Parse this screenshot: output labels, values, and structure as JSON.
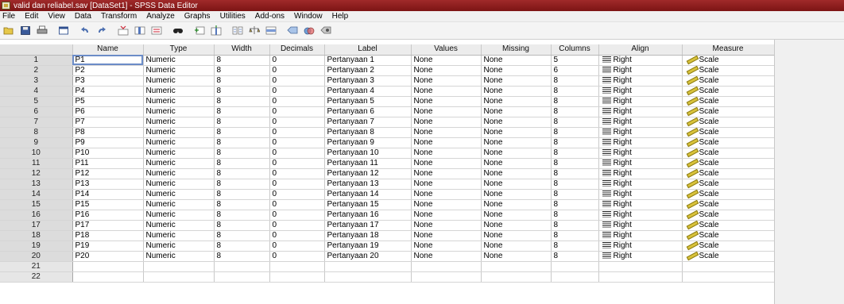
{
  "window": {
    "title": "valid dan reliabel.sav [DataSet1] - SPSS Data Editor"
  },
  "menu": {
    "items": [
      "File",
      "Edit",
      "View",
      "Data",
      "Transform",
      "Analyze",
      "Graphs",
      "Utilities",
      "Add-ons",
      "Window",
      "Help"
    ]
  },
  "toolbar": {
    "icons": [
      "open-icon",
      "save-icon",
      "print-icon",
      "dialog-recall-icon",
      "undo-icon",
      "redo-icon",
      "goto-case-icon",
      "goto-variable-icon",
      "variables-icon",
      "find-icon",
      "insert-cases-icon",
      "insert-variable-icon",
      "split-file-icon",
      "weight-cases-icon",
      "select-cases-icon",
      "value-labels-icon",
      "use-sets-icon",
      "show-all-variables-icon"
    ]
  },
  "grid": {
    "headers": [
      "Name",
      "Type",
      "Width",
      "Decimals",
      "Label",
      "Values",
      "Missing",
      "Columns",
      "Align",
      "Measure"
    ],
    "row_numbers": [
      "1",
      "2",
      "3",
      "4",
      "5",
      "6",
      "7",
      "8",
      "9",
      "10",
      "11",
      "12",
      "13",
      "14",
      "15",
      "16",
      "17",
      "18",
      "19",
      "20",
      "21",
      "22"
    ],
    "rows": [
      {
        "name": "P1",
        "type": "Numeric",
        "width": "8",
        "decimals": "0",
        "label": "Pertanyaan 1",
        "values": "None",
        "missing": "None",
        "columns": "5",
        "align": "Right",
        "measure": "Scale"
      },
      {
        "name": "P2",
        "type": "Numeric",
        "width": "8",
        "decimals": "0",
        "label": "Pertanyaan 2",
        "values": "None",
        "missing": "None",
        "columns": "6",
        "align": "Right",
        "measure": "Scale"
      },
      {
        "name": "P3",
        "type": "Numeric",
        "width": "8",
        "decimals": "0",
        "label": "Pertanyaan 3",
        "values": "None",
        "missing": "None",
        "columns": "8",
        "align": "Right",
        "measure": "Scale"
      },
      {
        "name": "P4",
        "type": "Numeric",
        "width": "8",
        "decimals": "0",
        "label": "Pertanyaan 4",
        "values": "None",
        "missing": "None",
        "columns": "8",
        "align": "Right",
        "measure": "Scale"
      },
      {
        "name": "P5",
        "type": "Numeric",
        "width": "8",
        "decimals": "0",
        "label": "Pertanyaan 5",
        "values": "None",
        "missing": "None",
        "columns": "8",
        "align": "Right",
        "measure": "Scale"
      },
      {
        "name": "P6",
        "type": "Numeric",
        "width": "8",
        "decimals": "0",
        "label": "Pertanyaan 6",
        "values": "None",
        "missing": "None",
        "columns": "8",
        "align": "Right",
        "measure": "Scale"
      },
      {
        "name": "P7",
        "type": "Numeric",
        "width": "8",
        "decimals": "0",
        "label": "Pertanyaan 7",
        "values": "None",
        "missing": "None",
        "columns": "8",
        "align": "Right",
        "measure": "Scale"
      },
      {
        "name": "P8",
        "type": "Numeric",
        "width": "8",
        "decimals": "0",
        "label": "Pertanyaan 8",
        "values": "None",
        "missing": "None",
        "columns": "8",
        "align": "Right",
        "measure": "Scale"
      },
      {
        "name": "P9",
        "type": "Numeric",
        "width": "8",
        "decimals": "0",
        "label": "Pertanyaan 9",
        "values": "None",
        "missing": "None",
        "columns": "8",
        "align": "Right",
        "measure": "Scale"
      },
      {
        "name": "P10",
        "type": "Numeric",
        "width": "8",
        "decimals": "0",
        "label": "Pertanyaan 10",
        "values": "None",
        "missing": "None",
        "columns": "8",
        "align": "Right",
        "measure": "Scale"
      },
      {
        "name": "P11",
        "type": "Numeric",
        "width": "8",
        "decimals": "0",
        "label": "Pertanyaan 11",
        "values": "None",
        "missing": "None",
        "columns": "8",
        "align": "Right",
        "measure": "Scale"
      },
      {
        "name": "P12",
        "type": "Numeric",
        "width": "8",
        "decimals": "0",
        "label": "Pertanyaan 12",
        "values": "None",
        "missing": "None",
        "columns": "8",
        "align": "Right",
        "measure": "Scale"
      },
      {
        "name": "P13",
        "type": "Numeric",
        "width": "8",
        "decimals": "0",
        "label": "Pertanyaan 13",
        "values": "None",
        "missing": "None",
        "columns": "8",
        "align": "Right",
        "measure": "Scale"
      },
      {
        "name": "P14",
        "type": "Numeric",
        "width": "8",
        "decimals": "0",
        "label": "Pertanyaan 14",
        "values": "None",
        "missing": "None",
        "columns": "8",
        "align": "Right",
        "measure": "Scale"
      },
      {
        "name": "P15",
        "type": "Numeric",
        "width": "8",
        "decimals": "0",
        "label": "Pertanyaan 15",
        "values": "None",
        "missing": "None",
        "columns": "8",
        "align": "Right",
        "measure": "Scale"
      },
      {
        "name": "P16",
        "type": "Numeric",
        "width": "8",
        "decimals": "0",
        "label": "Pertanyaan 16",
        "values": "None",
        "missing": "None",
        "columns": "8",
        "align": "Right",
        "measure": "Scale"
      },
      {
        "name": "P17",
        "type": "Numeric",
        "width": "8",
        "decimals": "0",
        "label": "Pertanyaan 17",
        "values": "None",
        "missing": "None",
        "columns": "8",
        "align": "Right",
        "measure": "Scale"
      },
      {
        "name": "P18",
        "type": "Numeric",
        "width": "8",
        "decimals": "0",
        "label": "Pertanyaan 18",
        "values": "None",
        "missing": "None",
        "columns": "8",
        "align": "Right",
        "measure": "Scale"
      },
      {
        "name": "P19",
        "type": "Numeric",
        "width": "8",
        "decimals": "0",
        "label": "Pertanyaan 19",
        "values": "None",
        "missing": "None",
        "columns": "8",
        "align": "Right",
        "measure": "Scale"
      },
      {
        "name": "P20",
        "type": "Numeric",
        "width": "8",
        "decimals": "0",
        "label": "Pertanyaan 20",
        "values": "None",
        "missing": "None",
        "columns": "8",
        "align": "Right",
        "measure": "Scale"
      }
    ],
    "active_cell": {
      "row": 1,
      "column": "name"
    }
  },
  "colors": {
    "titlebar": "#8b1c1c",
    "active_cell_border": "#6b8cc8",
    "header_bg": "#ececec"
  }
}
